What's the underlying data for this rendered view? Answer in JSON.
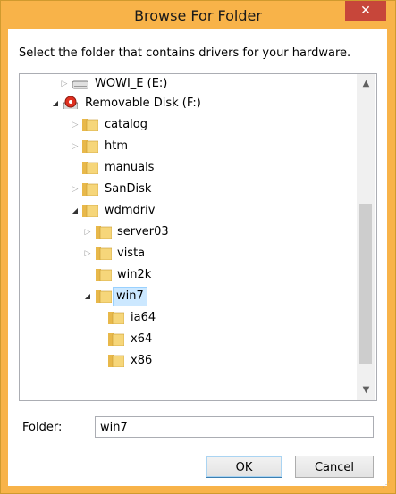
{
  "window": {
    "title": "Browse For Folder",
    "close_glyph": "✕",
    "accent_color": "#f8b349",
    "close_color": "#c7463a"
  },
  "dialog": {
    "instruction": "Select the folder that contains drivers for your hardware."
  },
  "tree": {
    "items": [
      {
        "label": "WOWI_E (E:)",
        "icon": "drive-icon",
        "expander": "collapsed"
      },
      {
        "label": "Removable Disk (F:)",
        "icon": "removable-disk-icon",
        "expander": "expanded"
      },
      {
        "label": "catalog",
        "icon": "folder-icon",
        "expander": "collapsed"
      },
      {
        "label": "htm",
        "icon": "folder-icon",
        "expander": "collapsed"
      },
      {
        "label": "manuals",
        "icon": "folder-icon",
        "expander": "none"
      },
      {
        "label": "SanDisk",
        "icon": "folder-icon",
        "expander": "collapsed"
      },
      {
        "label": "wdmdriv",
        "icon": "folder-icon",
        "expander": "expanded"
      },
      {
        "label": "server03",
        "icon": "folder-icon",
        "expander": "collapsed"
      },
      {
        "label": "vista",
        "icon": "folder-icon",
        "expander": "collapsed"
      },
      {
        "label": "win2k",
        "icon": "folder-icon",
        "expander": "none"
      },
      {
        "label": "win7",
        "icon": "folder-icon",
        "expander": "expanded",
        "selected": true
      },
      {
        "label": "ia64",
        "icon": "folder-icon",
        "expander": "none"
      },
      {
        "label": "x64",
        "icon": "folder-icon",
        "expander": "none"
      },
      {
        "label": "x86",
        "icon": "folder-icon",
        "expander": "none"
      }
    ],
    "selection_color": "#cce8ff"
  },
  "folder_field": {
    "label": "Folder:",
    "value": "win7"
  },
  "buttons": {
    "ok": "OK",
    "cancel": "Cancel"
  }
}
